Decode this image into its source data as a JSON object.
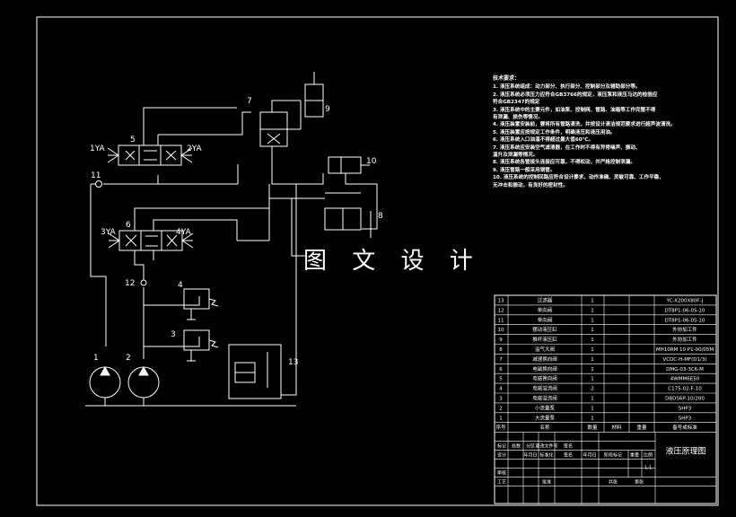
{
  "diagram": {
    "watermark": "图 文 设 计",
    "component_labels": {
      "c1": "1",
      "c2": "2",
      "c3": "3",
      "c4": "4",
      "c5": "5",
      "c6": "6",
      "c7": "7",
      "c8": "8",
      "c9": "9",
      "c10": "10",
      "c11": "11",
      "c12": "12",
      "c13": "13",
      "s1": "1YA",
      "s2": "2YA",
      "s3": "3YA",
      "s4": "4YA"
    }
  },
  "tech_notes": {
    "title": "技术要求：",
    "lines": [
      "1. 液压系统组成：动力部分、执行部分、控制部分及辅助部分等。",
      "2. 液压系统必须压力应符合GB3766的规定，液压泵和液压马达的检验应",
      "符合GB2347的规定",
      "3. 液压系统中的主要元件，如油泵、控制阀、管路、油箱等工作完整不得",
      "有泄漏、损伤等情况。",
      "4. 液压装置安装前，要将所有管路清洗，并按设计清洁规范要求进行超声波清洗。",
      "5. 液压装置应按规定工作条件，明确液压和液压用油。",
      "6. 液压系统入口油温不得超过最大值60℃。",
      "7. 液压系统应安装空气滤清器，在工作时不得有异常噪声、振动、",
      "温升及泄漏等情况。",
      "8. 液压系统各管接头连接应可靠，不得松动，并严格控制泄漏。",
      "9. 液压管路一般采用钢管。",
      "10. 液压系统的控制回路应符合设计要求，动作准确、灵敏可靠、工作平稳，",
      "无冲击和振动，有良好的密封性。"
    ]
  },
  "parts_list": {
    "rows": [
      {
        "no": "13",
        "name": "过滤器",
        "qty": "1",
        "spec": "YC-X200X80F-J"
      },
      {
        "no": "12",
        "name": "单向阀",
        "qty": "1",
        "spec": "DT8P1-06-05-10"
      },
      {
        "no": "11",
        "name": "单向阀",
        "qty": "1",
        "spec": "DT8P1-06-05-10"
      },
      {
        "no": "10",
        "name": "摆动液压缸",
        "qty": "1",
        "spec": "外协加工件"
      },
      {
        "no": "9",
        "name": "推杆液压缸",
        "qty": "1",
        "spec": "外协加工件"
      },
      {
        "no": "8",
        "name": "溢气大阀",
        "qty": "1",
        "spec": "MH10RM 10 P1-00/05M"
      },
      {
        "no": "7",
        "name": "减速换向阀",
        "qty": "1",
        "spec": "VCDC-H-MF(D1/3)"
      },
      {
        "no": "6",
        "name": "电磁换向阀",
        "qty": "1",
        "spec": "DMG-03-3C6-M"
      },
      {
        "no": "5",
        "name": "电磁换向阀",
        "qty": "1",
        "spec": "4WMM6E50"
      },
      {
        "no": "4",
        "name": "电磁溢流阀",
        "qty": "2",
        "spec": "C175-02-F-10"
      },
      {
        "no": "3",
        "name": "电磁溢流阀",
        "qty": "1",
        "spec": "DBDS6P-10/200"
      },
      {
        "no": "2",
        "name": "小流量泵",
        "qty": "1",
        "spec": "SHP3"
      },
      {
        "no": "1",
        "name": "大流量泵",
        "qty": "1",
        "spec": "SHP3"
      }
    ],
    "headers": {
      "no": "序号",
      "name": "名称",
      "qty": "数量",
      "material": "材料",
      "weight": "重量",
      "remark": "备号或标准"
    }
  },
  "title_block": {
    "drawing_name": "液压原理图",
    "scale": "1:1",
    "labels": {
      "mark": "标记",
      "count": "处数",
      "zone": "分区",
      "doc": "更改文件号",
      "sign": "签名",
      "design": "设计",
      "std": "标准化",
      "stage": "阶段标记",
      "weight": "重量",
      "ratio": "比例",
      "review": "审核",
      "process": "工艺",
      "approve": "批准",
      "total": "共张",
      "sheet": "第张",
      "date": "年月日",
      "sign2": "签名",
      "date2": "年月日"
    }
  }
}
